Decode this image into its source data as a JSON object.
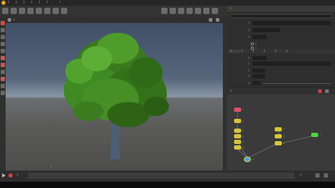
{
  "window": {
    "title": "?"
  },
  "menu": {
    "items": [
      "?",
      "?",
      "?",
      "?",
      "?",
      "?",
      "?"
    ]
  },
  "viewport": {
    "camera_label": "?",
    "overlay_text": "?"
  },
  "parameters": {
    "node_name": "?",
    "tabs": [
      "?",
      "?",
      "?",
      "?",
      "?",
      "?"
    ],
    "rows": [
      "?",
      "?",
      "?",
      "?",
      "?",
      "?",
      "?",
      "?",
      "?",
      "?",
      "?",
      "?",
      "?"
    ]
  },
  "network": {
    "path": "?",
    "nodes": [
      {
        "label": "?",
        "kind": "red"
      },
      {
        "label": "?",
        "kind": "yellow"
      },
      {
        "label": "?",
        "kind": "yellow"
      },
      {
        "label": "?",
        "kind": "yellow"
      },
      {
        "label": "?",
        "kind": "yellow"
      },
      {
        "label": "?",
        "kind": "yellow"
      },
      {
        "label": "?",
        "kind": "yellow"
      },
      {
        "label": "?",
        "kind": "yellow"
      },
      {
        "label": "?",
        "kind": "yellow"
      },
      {
        "label": "?",
        "kind": "green"
      },
      {
        "label": "?",
        "kind": "merge"
      }
    ]
  },
  "timeline": {
    "frame_start": "?",
    "frame_end": "?"
  },
  "colors": {
    "sky_top": "#3e4d64",
    "sky_bottom": "#8a96a6",
    "ground": "#5b5b59",
    "accent": "#e8a320",
    "node_yellow": "#d8c43a",
    "node_red": "#e0506a",
    "node_green": "#4fd14f"
  },
  "icons": [
    "houdini-logo-icon",
    "shelf-tool-icon",
    "select-icon",
    "camera-icon",
    "node-icon",
    "play-icon",
    "record-icon"
  ]
}
